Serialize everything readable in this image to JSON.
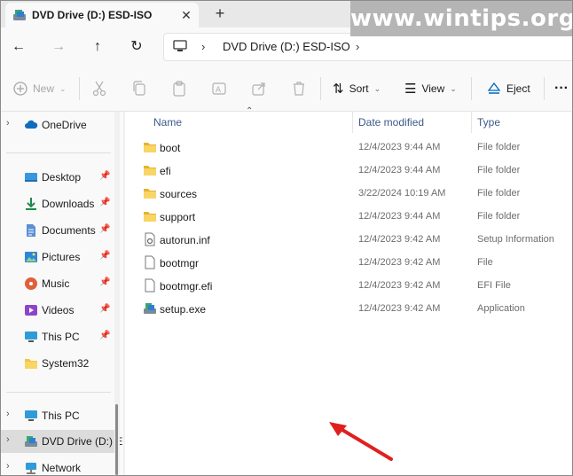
{
  "window": {
    "tab_title": "DVD Drive (D:) ESD-ISO",
    "close_glyph": "✕",
    "new_tab_glyph": "+"
  },
  "watermark": "www.wintips.org",
  "nav": {
    "back": "←",
    "forward": "→",
    "up": "↑",
    "refresh": "↻",
    "address_path": "DVD Drive (D:) ESD-ISO"
  },
  "toolbar": {
    "new_label": "New",
    "sort_label": "Sort",
    "view_label": "View",
    "eject_label": "Eject",
    "more_label": "···"
  },
  "sidebar": {
    "items": [
      {
        "label": "OneDrive",
        "icon": "cloud-icon"
      },
      {
        "label": "Desktop",
        "icon": "desktop-icon"
      },
      {
        "label": "Downloads",
        "icon": "download-icon"
      },
      {
        "label": "Documents",
        "icon": "document-icon"
      },
      {
        "label": "Pictures",
        "icon": "picture-icon"
      },
      {
        "label": "Music",
        "icon": "music-icon"
      },
      {
        "label": "Videos",
        "icon": "video-icon"
      },
      {
        "label": "This PC",
        "icon": "pc-icon"
      },
      {
        "label": "System32",
        "icon": "folder-icon"
      },
      {
        "label": "This PC",
        "icon": "pc-icon"
      },
      {
        "label": "DVD Drive (D:) E",
        "icon": "dvd-drive-icon"
      },
      {
        "label": "Network",
        "icon": "network-icon"
      }
    ]
  },
  "columns": {
    "name": "Name",
    "date": "Date modified",
    "type": "Type"
  },
  "files": [
    {
      "name": "boot",
      "date": "12/4/2023 9:44 AM",
      "type": "File folder",
      "icon": "folder-icon"
    },
    {
      "name": "efi",
      "date": "12/4/2023 9:44 AM",
      "type": "File folder",
      "icon": "folder-icon"
    },
    {
      "name": "sources",
      "date": "3/22/2024 10:19 AM",
      "type": "File folder",
      "icon": "folder-icon"
    },
    {
      "name": "support",
      "date": "12/4/2023 9:44 AM",
      "type": "File folder",
      "icon": "folder-icon"
    },
    {
      "name": "autorun.inf",
      "date": "12/4/2023 9:42 AM",
      "type": "Setup Information",
      "icon": "settings-file-icon"
    },
    {
      "name": "bootmgr",
      "date": "12/4/2023 9:42 AM",
      "type": "File",
      "icon": "file-icon"
    },
    {
      "name": "bootmgr.efi",
      "date": "12/4/2023 9:42 AM",
      "type": "EFI File",
      "icon": "file-icon"
    },
    {
      "name": "setup.exe",
      "date": "12/4/2023 9:42 AM",
      "type": "Application",
      "icon": "setup-app-icon"
    }
  ],
  "colors": {
    "accent": "#0067c0",
    "folder": "#f4c542",
    "annotation_arrow": "#e02020"
  }
}
